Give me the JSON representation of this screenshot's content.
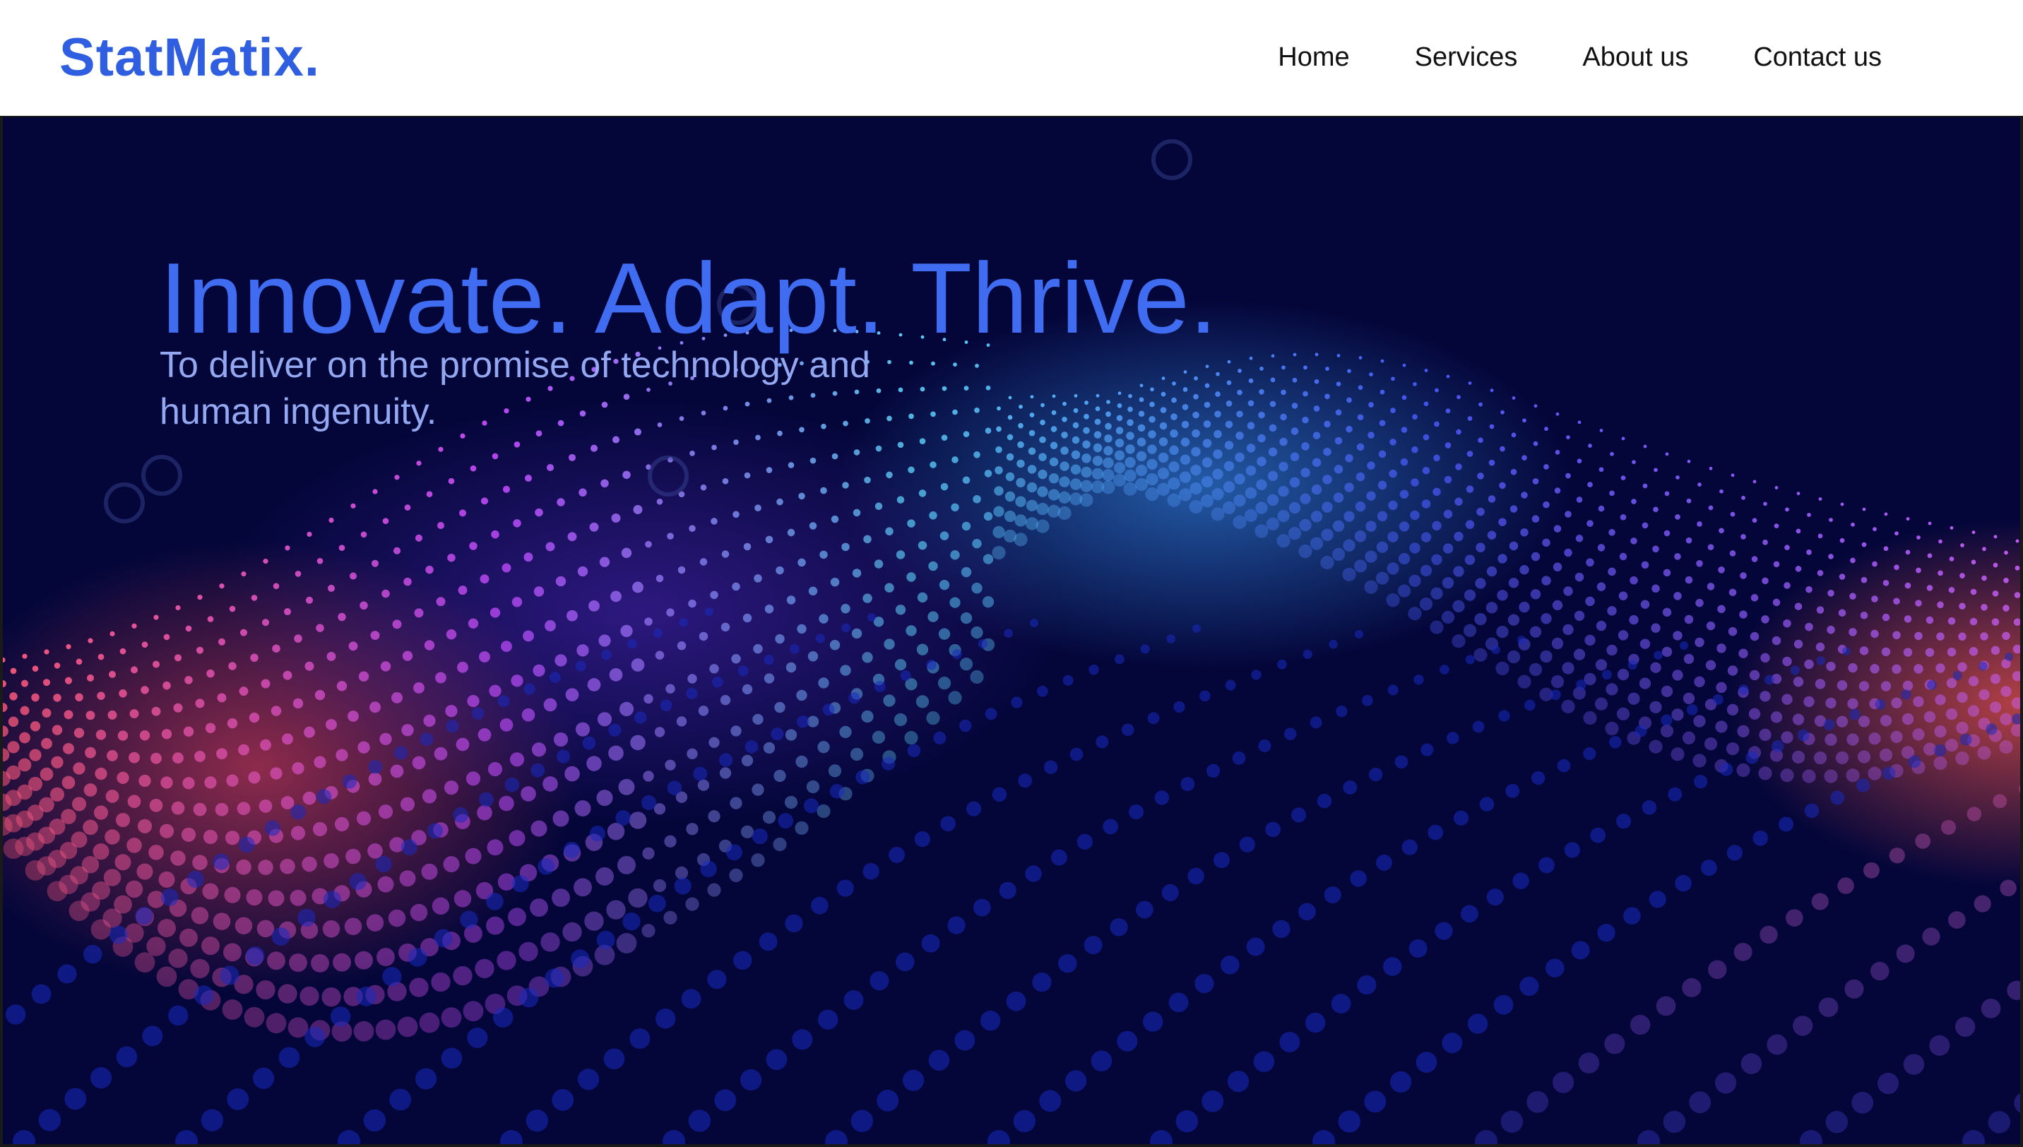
{
  "brand": {
    "logo_text": "StatMatix.",
    "color": "#2f5fe0"
  },
  "nav": {
    "items": [
      {
        "label": "Home"
      },
      {
        "label": "Services"
      },
      {
        "label": "About us"
      },
      {
        "label": "Contact us"
      }
    ]
  },
  "hero": {
    "headline": "Innovate. Adapt. Thrive.",
    "subheadline": "To deliver on the promise of technology and human ingenuity.",
    "background_color": "#04063a",
    "accent_colors": [
      "#3f6cf0",
      "#ff5a7a",
      "#b54dff",
      "#5fd8ff"
    ]
  }
}
